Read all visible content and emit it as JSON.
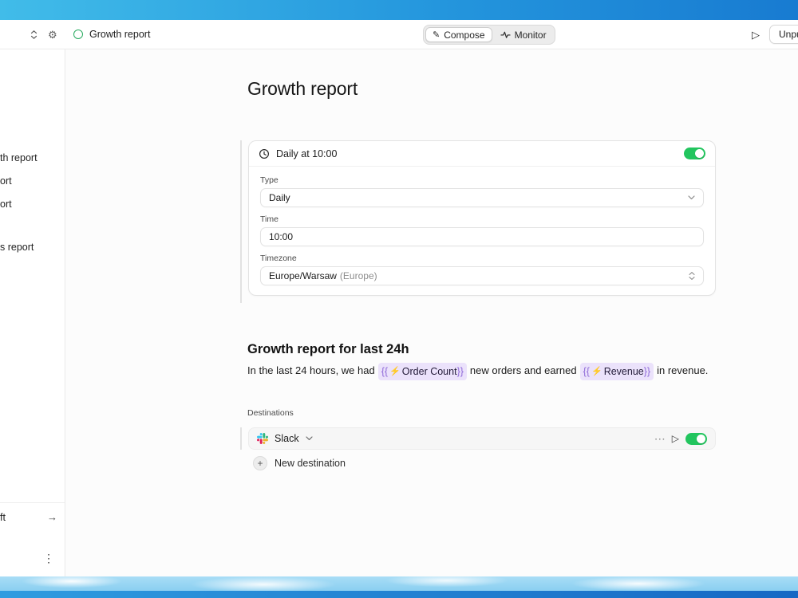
{
  "icons": {
    "gear": "⚙",
    "pencil": "✎",
    "play": "▷",
    "bolt": "⚡",
    "plus": "+",
    "arrow_right": "→",
    "dots_vertical": "⋮",
    "dots_horizontal": "⋯"
  },
  "colors": {
    "toggle_on": "#22c55e",
    "chip_bg": "#ebe2fb",
    "status_ring_green": "#2bab61",
    "slack_blue": "#36C5F0",
    "slack_green": "#2EB67D",
    "slack_yellow": "#ECB22E",
    "slack_red": "#E01E5A"
  },
  "header": {
    "title": "Growth report",
    "segments": [
      {
        "label": "Compose",
        "selected": true
      },
      {
        "label": "Monitor",
        "selected": false
      }
    ],
    "unpublish_label": "Unpublish"
  },
  "sidebar": {
    "items": [
      {
        "label": "th report"
      },
      {
        "label": "ort"
      },
      {
        "label": "ort"
      },
      {
        "label": "s report"
      }
    ],
    "bottom_item": {
      "label": "ft"
    }
  },
  "main": {
    "page_title": "Growth report",
    "schedule": {
      "title": "Daily at 10:00",
      "enabled": true,
      "type_label": "Type",
      "type_value": "Daily",
      "time_label": "Time",
      "time_value": "10:00",
      "timezone_label": "Timezone",
      "timezone_value": "Europe/Warsaw",
      "timezone_suffix": "(Europe)"
    },
    "report": {
      "heading": "Growth report for last 24h",
      "part1": "In the last 24 hours, we had",
      "part2": "new orders and earned",
      "part3": "in revenue.",
      "var1": {
        "open": "{{",
        "label": "Order Count",
        "close": "}}"
      },
      "var2": {
        "open": "{{",
        "label": "Revenue",
        "close": "}}"
      }
    },
    "destinations": {
      "label": "Destinations",
      "slack": {
        "name": "Slack",
        "enabled": true
      },
      "add_label": "New destination"
    }
  }
}
